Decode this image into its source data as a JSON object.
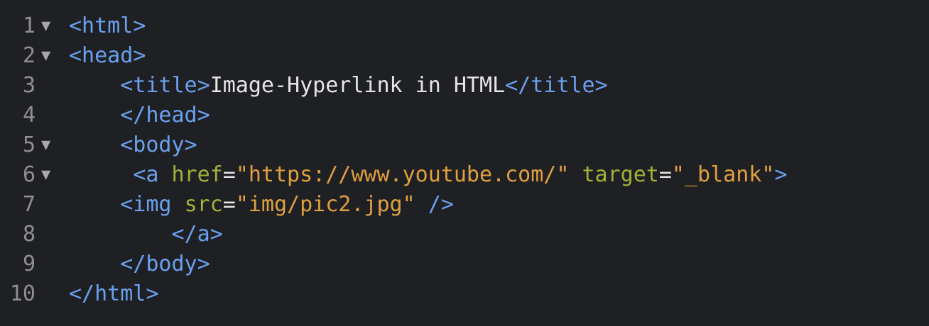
{
  "colors": {
    "background": "#1f2023",
    "tag": "#6aa0f0",
    "attribute": "#9fb33a",
    "string": "#e0a040",
    "text": "#e6e6e6",
    "line_number": "#8f8f8f"
  },
  "fold_icon": "triangle-down-icon",
  "lines": [
    {
      "number": "1",
      "fold": "▼",
      "indent": "",
      "tokens": [
        [
          "tag",
          "<html>"
        ]
      ]
    },
    {
      "number": "2",
      "fold": "▼",
      "indent": "",
      "tokens": [
        [
          "tag",
          "<head>"
        ]
      ]
    },
    {
      "number": "3",
      "fold": "",
      "indent": "    ",
      "tokens": [
        [
          "tag",
          "<title>"
        ],
        [
          "txt",
          "Image-Hyperlink in HTML"
        ],
        [
          "tag",
          "</title>"
        ]
      ]
    },
    {
      "number": "4",
      "fold": "",
      "indent": "    ",
      "tokens": [
        [
          "tag",
          "</head>"
        ]
      ]
    },
    {
      "number": "5",
      "fold": "▼",
      "indent": "    ",
      "tokens": [
        [
          "tag",
          "<body>"
        ]
      ]
    },
    {
      "number": "6",
      "fold": "▼",
      "indent": "     ",
      "tokens": [
        [
          "tag",
          "<a "
        ],
        [
          "attr",
          "href"
        ],
        [
          "eq",
          "="
        ],
        [
          "str",
          "\"https://www.youtube.com/\""
        ],
        [
          "txt",
          " "
        ],
        [
          "attr",
          "target"
        ],
        [
          "eq",
          "="
        ],
        [
          "str",
          "\"_blank\""
        ],
        [
          "tag",
          ">"
        ]
      ]
    },
    {
      "number": "7",
      "fold": "",
      "indent": "    ",
      "tokens": [
        [
          "tag",
          "<img "
        ],
        [
          "attr",
          "src"
        ],
        [
          "eq",
          "="
        ],
        [
          "str",
          "\"img/pic2.jpg\""
        ],
        [
          "txt",
          " "
        ],
        [
          "tag",
          "/>"
        ]
      ]
    },
    {
      "number": "8",
      "fold": "",
      "indent": "        ",
      "tokens": [
        [
          "tag",
          "</a>"
        ]
      ]
    },
    {
      "number": "9",
      "fold": "",
      "indent": "    ",
      "tokens": [
        [
          "tag",
          "</body>"
        ]
      ]
    },
    {
      "number": "10",
      "fold": "",
      "indent": "",
      "tokens": [
        [
          "tag",
          "</html>"
        ]
      ]
    }
  ]
}
